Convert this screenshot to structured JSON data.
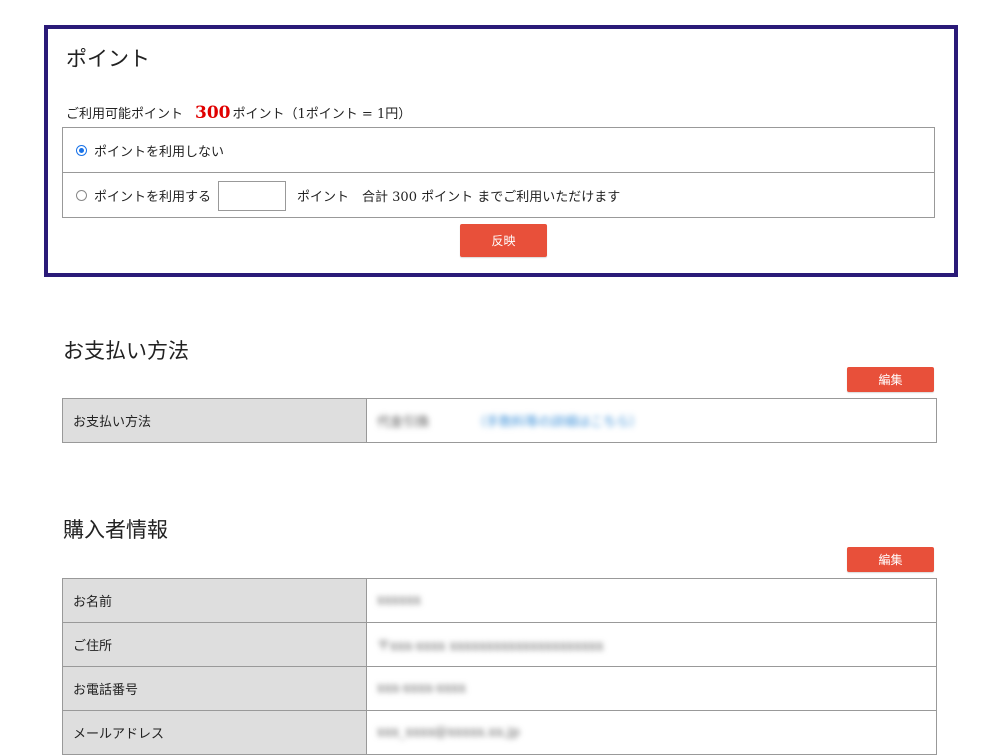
{
  "point": {
    "title": "ポイント",
    "available_label": "ご利用可能ポイント",
    "available_points": "300",
    "available_suffix": "ポイント（1ポイント = 1円）",
    "option_no_use": "ポイントを利用しない",
    "option_use": "ポイントを利用する",
    "option_use_tail": "ポイント　合計 300 ポイント までご利用いただけます",
    "points_input_value": "",
    "reflect_button": "反映"
  },
  "payment": {
    "title": "お支払い方法",
    "edit_button": "編集",
    "rows": [
      {
        "label": "お支払い方法",
        "value": "代金引換",
        "link": "（手数料等の詳細はこちら）"
      }
    ]
  },
  "buyer": {
    "title": "購入者情報",
    "edit_button": "編集",
    "rows": [
      {
        "label": "お名前",
        "value": "xxxxxx"
      },
      {
        "label": "ご住所",
        "value": "〒xxx-xxxx xxxxxxxxxxxxxxxxxxxxx"
      },
      {
        "label": "お電話番号",
        "value": "xxx-xxxx-xxxx"
      },
      {
        "label": "メールアドレス",
        "value": "xxx_xxxx@xxxxx.xx.jp"
      }
    ]
  },
  "colors": {
    "accent_button": "#e8503a",
    "point_box_border": "#2a1a78",
    "points_number": "#e00000",
    "label_cell_bg": "#dedede"
  }
}
